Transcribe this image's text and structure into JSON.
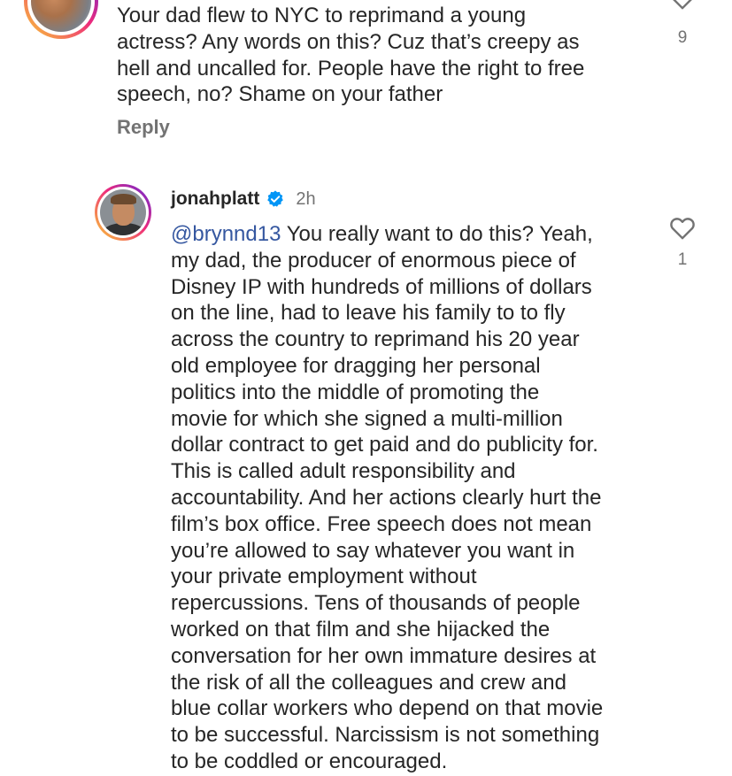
{
  "top_comment": {
    "text": "Your dad flew to NYC to reprimand a young\nactress? Any words on this? Cuz that’s creepy as\nhell and uncalled for. People have the right to free\nspeech, no? Shame on your father",
    "reply_label": "Reply",
    "like_count": "9",
    "like_icon": "heart-outline-icon"
  },
  "reply_comment": {
    "username": "jonahplatt",
    "verified_icon": "verified-badge-icon",
    "time": "2h",
    "mention": "@brynnd13",
    "text": " You really want to do this? Yeah,\nmy dad, the producer of enormous piece of\nDisney IP with hundreds of millions of dollars\non the line, had to leave his family to to fly\nacross the country to reprimand his 20 year\nold employee for dragging her personal\npolitics into the middle of promoting the\nmovie for which she signed a multi-million\ndollar contract to get paid and do publicity for.\nThis is called adult responsibility and\naccountability. And her actions clearly hurt the\nfilm’s box office. Free speech does not mean\nyou’re allowed to say whatever you want in\nyour private employment without\nrepercussions. Tens of thousands of people\nworked on that film and she hijacked the\nconversation for her own immature desires at\nthe risk of all the colleagues and crew and\nblue collar workers who depend on that movie\nto be successful. Narcissism is not something\nto be coddled or encouraged.",
    "like_count": "1",
    "like_icon": "heart-outline-icon"
  },
  "colors": {
    "text": "#262626",
    "muted": "#737373",
    "mention": "#3557a0",
    "verified": "#0095f6"
  }
}
